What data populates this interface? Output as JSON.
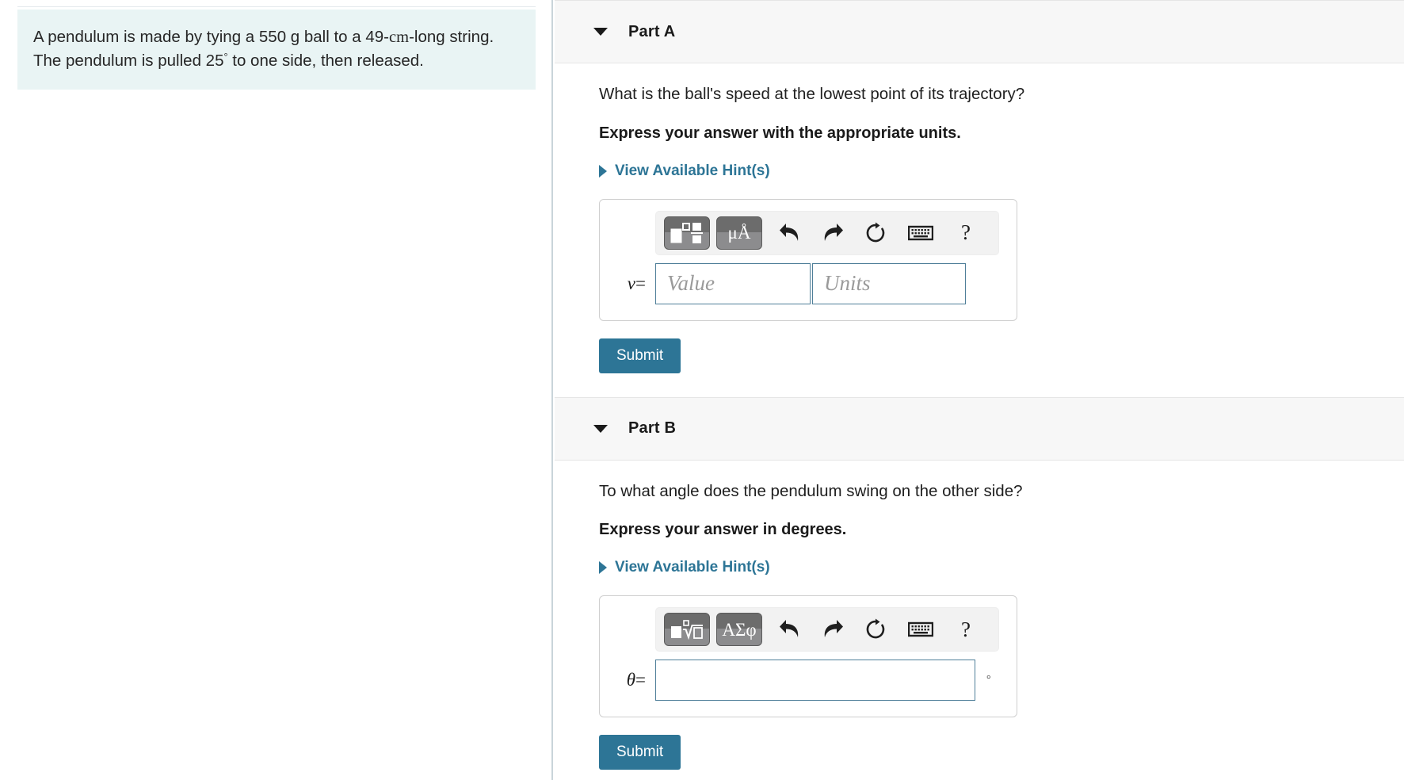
{
  "problem": {
    "statement_part1": "A pendulum is made by tying a 550 g ball to a 49-",
    "statement_unit": "cm",
    "statement_part2": "-long string. The pendulum is pulled 25",
    "statement_degree": "°",
    "statement_part3": " to one side, then released."
  },
  "colors": {
    "statement_bg": "#e9f4f4",
    "accent_link": "#2d7596",
    "submit_bg": "#2d7596",
    "part_header_bg": "#f7f7f7",
    "input_border": "#4f7f99"
  },
  "parts": [
    {
      "id": "A",
      "title": "Part A",
      "caret_icon": "caret-down-icon",
      "question": "What is the ball's speed at the lowest point of its trajectory?",
      "express": "Express your answer with the appropriate units.",
      "hint_label": "View Available Hint(s)",
      "hint_caret_icon": "caret-right-icon",
      "toolbar": {
        "template_button_label": "template-fraction-superscript",
        "symbols_button_label": "μÅ",
        "undo_label": "undo-arrow-icon",
        "redo_label": "redo-arrow-icon",
        "reset_label": "reset-circular-arrow-icon",
        "keyboard_label": "keyboard-icon",
        "help_label": "?"
      },
      "variable": "v",
      "equals": "=",
      "value_placeholder": "Value",
      "value": "",
      "units_placeholder": "Units",
      "units": "",
      "submit_label": "Submit"
    },
    {
      "id": "B",
      "title": "Part B",
      "caret_icon": "caret-down-icon",
      "question": "To what angle does the pendulum swing on the other side?",
      "express": "Express your answer in degrees.",
      "hint_label": "View Available Hint(s)",
      "hint_caret_icon": "caret-right-icon",
      "toolbar": {
        "template_button_label": "template-nth-root",
        "symbols_button_label": "ΑΣφ",
        "undo_label": "undo-arrow-icon",
        "redo_label": "redo-arrow-icon",
        "reset_label": "reset-circular-arrow-icon",
        "keyboard_label": "keyboard-icon",
        "help_label": "?"
      },
      "variable": "θ",
      "equals": "=",
      "value_placeholder": "",
      "value": "",
      "unit_suffix": "°",
      "submit_label": "Submit"
    }
  ]
}
